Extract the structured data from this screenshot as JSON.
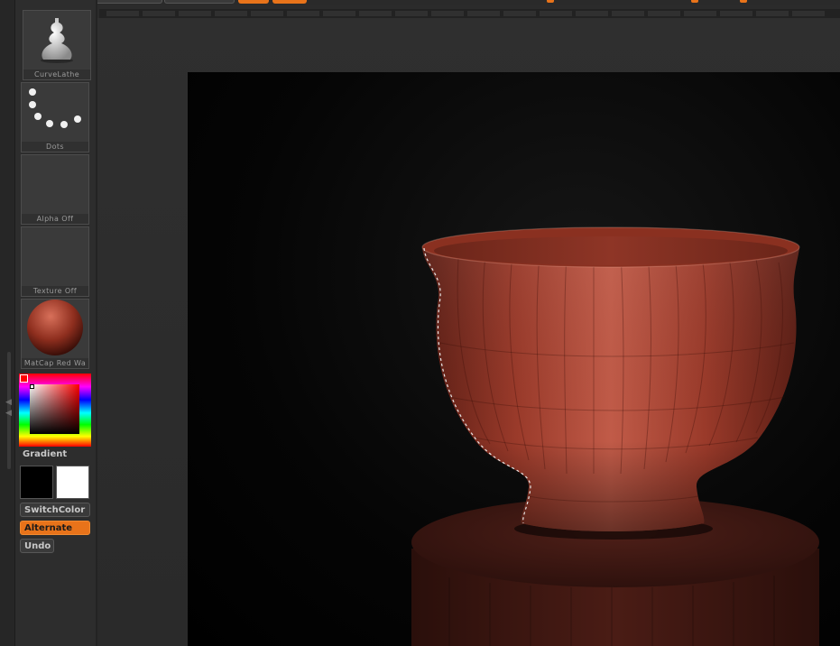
{
  "shelf": {
    "brush_label": "CurveLathe",
    "stroke_label": "Dots",
    "alpha_label": "Alpha Off",
    "texture_label": "Texture Off",
    "material_label": "MatCap Red Wa",
    "gradient_label": "Gradient",
    "switch_color_label": "SwitchColor",
    "alternate_label": "Alternate",
    "undo_label": "Undo"
  },
  "colors": {
    "accent": "#e8731a",
    "main_color": "#000000",
    "secondary_color": "#ffffff",
    "model_color": "#9a3a2a",
    "picker_selected": "#ffffff"
  },
  "icons": {
    "brush": "lathe-vase-icon",
    "stroke": "dots-stroke-icon",
    "material": "matcap-sphere-icon"
  }
}
